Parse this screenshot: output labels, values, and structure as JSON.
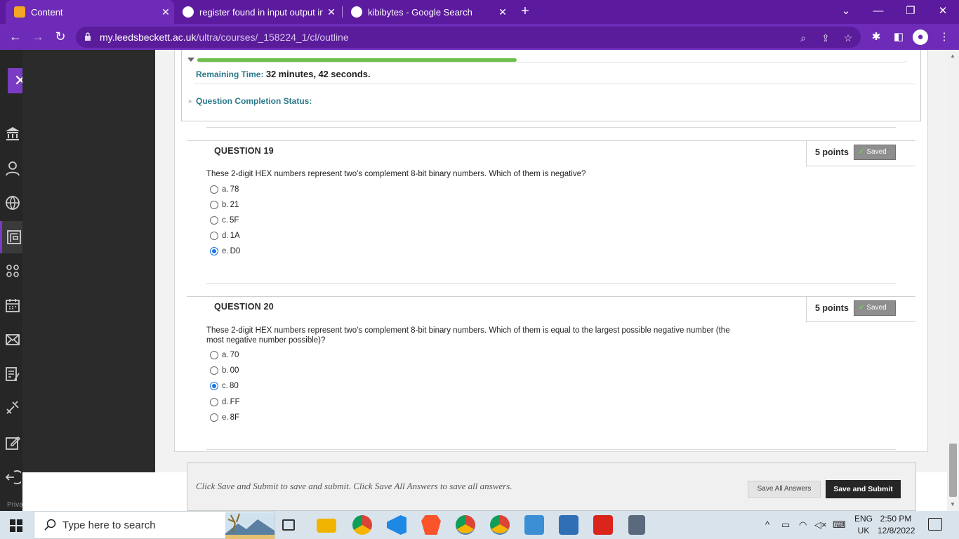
{
  "browser": {
    "tabs": [
      {
        "title": "Content",
        "active": true
      },
      {
        "title": "register found in input output int",
        "active": false
      },
      {
        "title": "kibibytes - Google Search",
        "active": false
      }
    ],
    "url_host": "my.leedsbeckett.ac.uk",
    "url_path": "/ultra/courses/_158224_1/cl/outline",
    "accent_color": "#6e2bb8"
  },
  "test": {
    "remaining_label": "Remaining Time:",
    "remaining_minutes": "32",
    "minutes_word": "minutes,",
    "remaining_seconds": "42",
    "seconds_word": "seconds.",
    "progress_fraction": 0.45,
    "completion_status_label": "Question Completion Status:"
  },
  "questions": [
    {
      "title": "QUESTION 19",
      "points": "5 points",
      "saved": "Saved",
      "text": "These 2-digit HEX numbers represent two's complement 8-bit binary numbers. Which of them is negative?",
      "options": [
        {
          "letter": "a.",
          "value": "78",
          "selected": false
        },
        {
          "letter": "b.",
          "value": "21",
          "selected": false
        },
        {
          "letter": "c.",
          "value": "5F",
          "selected": false
        },
        {
          "letter": "d.",
          "value": "1A",
          "selected": false
        },
        {
          "letter": "e.",
          "value": "D0",
          "selected": true
        }
      ]
    },
    {
      "title": "QUESTION 20",
      "points": "5 points",
      "saved": "Saved",
      "text": "These 2-digit HEX numbers represent two's complement 8-bit binary numbers. Which of them is equal to the largest possible negative number (the most negative number possible)?",
      "options": [
        {
          "letter": "a.",
          "value": "70",
          "selected": false
        },
        {
          "letter": "b.",
          "value": "00",
          "selected": false
        },
        {
          "letter": "c.",
          "value": "80",
          "selected": true
        },
        {
          "letter": "d.",
          "value": "FF",
          "selected": false
        },
        {
          "letter": "e.",
          "value": "8F",
          "selected": false
        }
      ]
    }
  ],
  "footer": {
    "note": "Click Save and Submit to save and submit. Click Save All Answers to save all answers.",
    "save_all": "Save All Answers",
    "save_submit": "Save and Submit"
  },
  "leftnav": {
    "close_symbol": "✕",
    "privacy": "Priva"
  },
  "taskbar": {
    "search_placeholder": "Type here to search",
    "lang_top": "ENG",
    "lang_bottom": "UK",
    "time": "2:50 PM",
    "date": "12/8/2022"
  }
}
